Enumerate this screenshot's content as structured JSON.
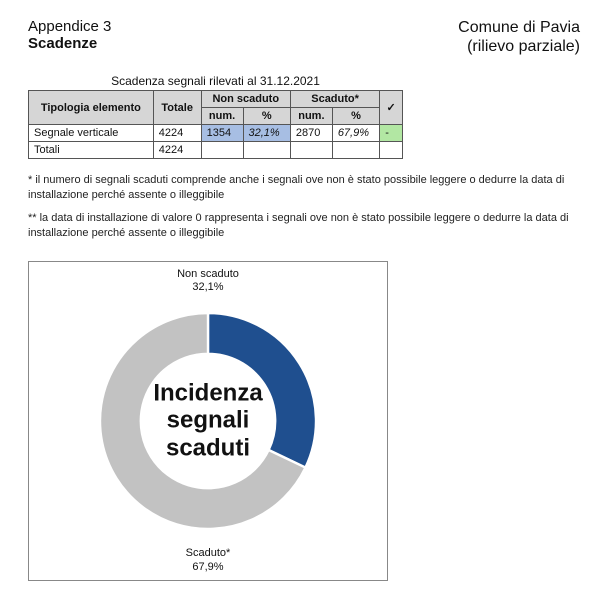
{
  "header": {
    "subtitle": "Appendice 3",
    "title": "Scadenze",
    "right_line1": "Comune di Pavia",
    "right_line2": "(rilievo parziale)"
  },
  "table": {
    "caption": "Scadenza segnali rilevati al 31.12.2021",
    "head": {
      "col_type": "Tipologia elemento",
      "col_total": "Totale",
      "grp_nonscaduto": "Non scaduto",
      "grp_scaduto": "Scaduto*",
      "col_num": "num.",
      "col_pct": "%",
      "col_check": "✓"
    },
    "rows": [
      {
        "name": "Segnale verticale",
        "total": "4224",
        "ns_num": "1354",
        "ns_pct": "32,1%",
        "s_num": "2870",
        "s_pct": "67,9%",
        "check": "-"
      }
    ],
    "totals_row": {
      "label": "Totali",
      "total": "4224"
    }
  },
  "footnotes": {
    "f1": "* il numero di segnali scaduti comprende anche i segnali ove non è stato possibile leggere o dedurre la data di installazione perché assente o illeggibile",
    "f2": "** la data di installazione di valore 0 rappresenta i segnali ove non è stato possibile leggere o dedurre la data di installazione perché assente o illeggibile"
  },
  "chart_data": {
    "type": "pie",
    "title": "Incidenza segnali scaduti",
    "series": [
      {
        "name": "Non scaduto",
        "value": 32.1,
        "label": "Non scaduto\n32,1%",
        "color": "#1f4f8f"
      },
      {
        "name": "Scaduto*",
        "value": 67.9,
        "label": "Scaduto*\n67,9%",
        "color": "#c2c2c2"
      }
    ],
    "top_label": {
      "line1": "Non scaduto",
      "line2": "32,1%"
    },
    "bottom_label": {
      "line1": "Scaduto*",
      "line2": "67,9%"
    },
    "center_text": {
      "l1": "Incidenza",
      "l2": "segnali",
      "l3": "scaduti"
    }
  }
}
